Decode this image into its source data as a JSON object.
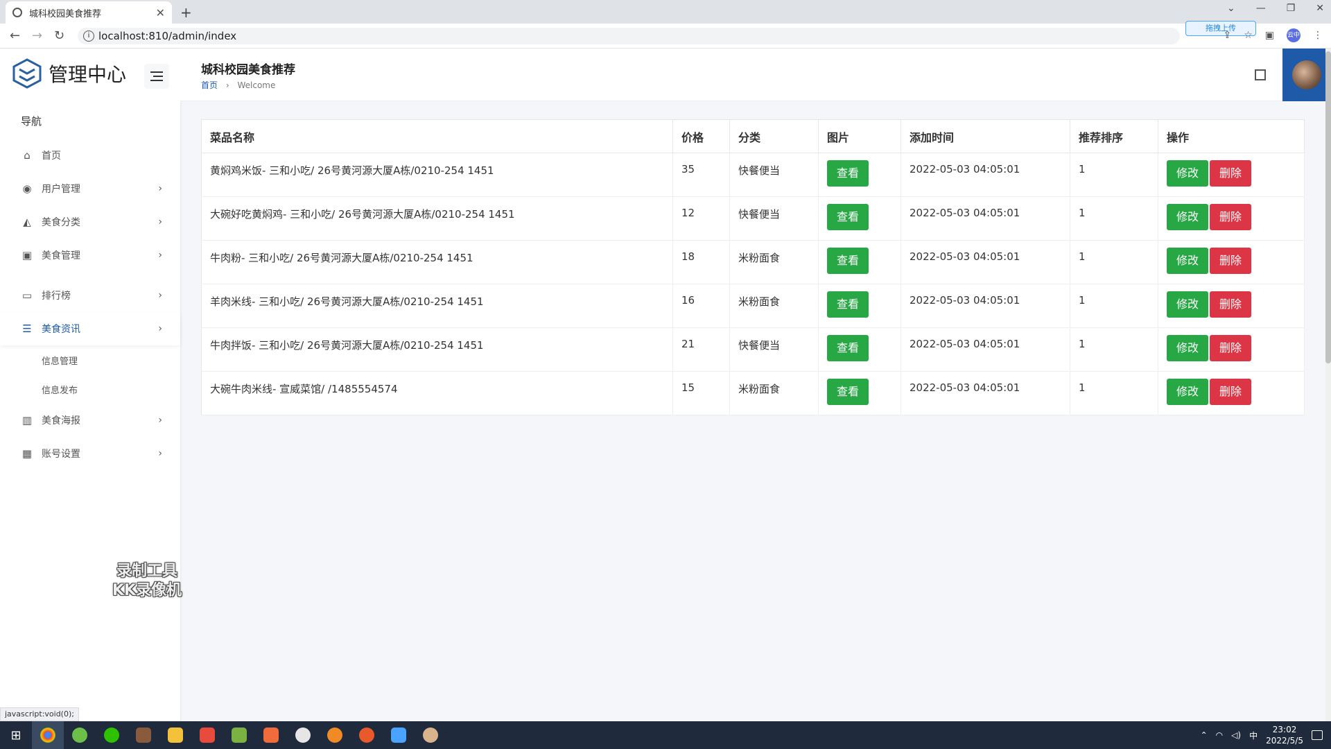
{
  "browser": {
    "tab_title": "城科校园美食推荐",
    "url": "localhost:810/admin/index",
    "upload_label": "拖拽上传",
    "profile_label": "云中",
    "status_link": "javascript:void(0);"
  },
  "sidebar": {
    "logo_text": "管理中心",
    "nav_heading": "导航",
    "items": [
      {
        "label": "首页",
        "icon": "home-icon"
      },
      {
        "label": "用户管理",
        "icon": "user-icon"
      },
      {
        "label": "美食分类",
        "icon": "category-icon"
      },
      {
        "label": "美食管理",
        "icon": "manage-icon"
      },
      {
        "label": "排行榜",
        "icon": "ranking-icon"
      },
      {
        "label": "美食资讯",
        "icon": "list-icon"
      },
      {
        "label": "美食海报",
        "icon": "poster-icon"
      },
      {
        "label": "账号设置",
        "icon": "settings-icon"
      }
    ],
    "sub_items": [
      "信息管理",
      "信息发布"
    ],
    "watermark_line1": "录制工具",
    "watermark_line2": "KK录像机"
  },
  "header": {
    "title": "城科校园美食推荐",
    "breadcrumb_home": "首页",
    "breadcrumb_current": "Welcome"
  },
  "table": {
    "columns": [
      "菜品名称",
      "价格",
      "分类",
      "图片",
      "添加时间",
      "推荐排序",
      "操作"
    ],
    "view_label": "查看",
    "edit_label": "修改",
    "delete_label": "删除",
    "rows": [
      {
        "name": "黄焖鸡米饭- 三和小吃/ 26号黄河源大厦A栋/0210-254 1451",
        "price": "35",
        "category": "快餐便当",
        "time": "2022-05-03 04:05:01",
        "rank": "1"
      },
      {
        "name": "大碗好吃黄焖鸡- 三和小吃/ 26号黄河源大厦A栋/0210-254 1451",
        "price": "12",
        "category": "快餐便当",
        "time": "2022-05-03 04:05:01",
        "rank": "1"
      },
      {
        "name": "牛肉粉- 三和小吃/ 26号黄河源大厦A栋/0210-254 1451",
        "price": "18",
        "category": "米粉面食",
        "time": "2022-05-03 04:05:01",
        "rank": "1"
      },
      {
        "name": "羊肉米线- 三和小吃/ 26号黄河源大厦A栋/0210-254 1451",
        "price": "16",
        "category": "米粉面食",
        "time": "2022-05-03 04:05:01",
        "rank": "1"
      },
      {
        "name": "牛肉拌饭- 三和小吃/ 26号黄河源大厦A栋/0210-254 1451",
        "price": "21",
        "category": "快餐便当",
        "time": "2022-05-03 04:05:01",
        "rank": "1"
      },
      {
        "name": "大碗牛肉米线- 宣威菜馆/ /1485554574",
        "price": "15",
        "category": "米粉面食",
        "time": "2022-05-03 04:05:01",
        "rank": "1"
      }
    ]
  },
  "taskbar": {
    "time": "23:02",
    "date": "2022/5/5",
    "ime": "中"
  },
  "colors": {
    "accent": "#1e5aa8",
    "green": "#28a745",
    "red": "#dc3545"
  }
}
